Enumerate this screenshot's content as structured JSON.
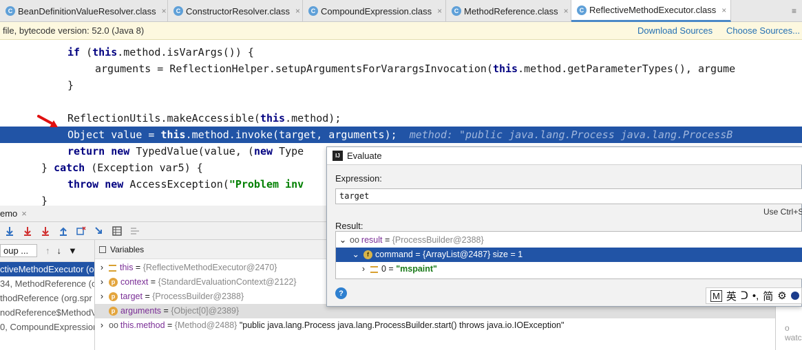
{
  "tabs": [
    {
      "label": "BeanDefinitionValueResolver.class",
      "close": "×"
    },
    {
      "label": "ConstructorResolver.class",
      "close": "×"
    },
    {
      "label": "CompoundExpression.class",
      "close": "×"
    },
    {
      "label": "MethodReference.class",
      "close": "×"
    },
    {
      "label": "ReflectiveMethodExecutor.class",
      "close": "×"
    }
  ],
  "tab_icon": "C",
  "tabbar_menu": "≡",
  "notice": {
    "text": "file, bytecode version: 52.0 (Java 8)",
    "download_sources": "Download Sources",
    "choose_sources": "Choose Sources..."
  },
  "code": {
    "line1_kw_if": "if",
    "line1_kw_this": "this",
    "line1_rest": ".method.isVarArgs()) {",
    "line2_a": "arguments = ReflectionHelper.setupArgumentsForVarargsInvocation(",
    "line2_this": "this",
    "line2_b": ".method.getParameterTypes(), argume",
    "line3": "}",
    "line5_a": "ReflectionUtils.makeAccessible(",
    "line5_this": "this",
    "line5_b": ".method);",
    "line6_a": "Object value = ",
    "line6_this": "this",
    "line6_b": ".method.invoke(target, arguments);",
    "line6_hint": "method: \"public java.lang.Process java.lang.ProcessB",
    "line7_return": "return",
    "line7_new": "new",
    "line7_a": "TypedValue(value, (",
    "line7_new2": "new",
    "line7_b": "Type",
    "line8_brace": "}",
    "line8_catch": "catch",
    "line8_rest": "(Exception var5) {",
    "line9_throw": "throw",
    "line9_new": "new",
    "line9_a": "AccessException(",
    "line9_str": "\"Problem inv",
    "line10": "}"
  },
  "debug": {
    "title": "emo",
    "title_close": "×",
    "frames_dropdown": "oup ...",
    "frames_pin": "→*",
    "frames": [
      "ctiveMethodExecutor (or",
      "34, MethodReference (o",
      "thodReference (org.spr",
      "nodReference$MethodV",
      "0, CompoundExpression"
    ],
    "variables_label": "Variables",
    "variables": [
      {
        "name": "this",
        "value": "{ReflectiveMethodExecutor@2470}"
      },
      {
        "name": "context",
        "value": "{StandardEvaluationContext@2122}"
      },
      {
        "name": "target",
        "value": "{ProcessBuilder@2388}"
      },
      {
        "name": "arguments",
        "value": "{Object[0]@2389}"
      },
      {
        "name": "this.method",
        "value": "{Method@2488}",
        "extra": "\"public java.lang.Process java.lang.ProcessBuilder.start() throws java.io.IOException\""
      }
    ],
    "watch_hint": "o watc"
  },
  "evaluate": {
    "title": "Evaluate",
    "expression_label": "Expression:",
    "expression_value": "target",
    "shortcut_hint": "Use Ctrl+Sh",
    "result_label": "Result:",
    "result_name": "result",
    "result_value": "{ProcessBuilder@2388}",
    "command_name": "command",
    "command_value": "{ArrayList@2487}  size = 1",
    "item_index": "0",
    "item_value": "\"mspaint\""
  },
  "ime": {
    "items": [
      "M",
      "英",
      "ᑐ",
      "•,",
      "简",
      "⚙"
    ]
  },
  "colors": {
    "selection": "#2154a6",
    "accent": "#4a88c7",
    "link": "#2470b3",
    "notice_bg": "#fdf8df"
  }
}
